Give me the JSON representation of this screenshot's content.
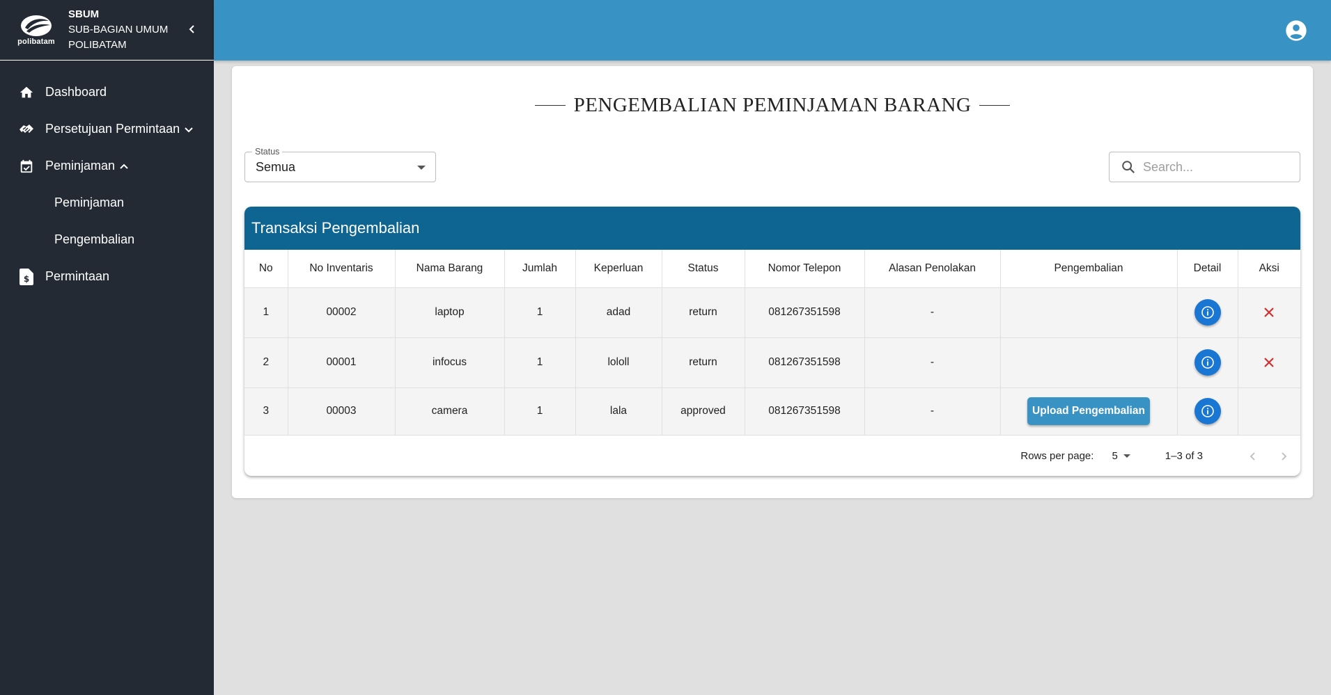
{
  "brand": {
    "logo_text": "polibatam",
    "line1": "SBUM",
    "line2": "SUB-BAGIAN UMUM",
    "line3": "POLIBATAM"
  },
  "sidebar": {
    "items": [
      {
        "label": "Dashboard",
        "icon": "home-icon"
      },
      {
        "label": "Persetujuan Permintaan",
        "icon": "handshake-icon",
        "chevron": "chevron-down-icon"
      },
      {
        "label": "Peminjaman",
        "icon": "calendar-check-icon",
        "chevron": "chevron-up-icon"
      },
      {
        "label": "Permintaan",
        "icon": "request-document-icon"
      }
    ],
    "subitems": [
      {
        "label": "Peminjaman"
      },
      {
        "label": "Pengembalian"
      }
    ]
  },
  "page": {
    "title": "PENGEMBALIAN PEMINJAMAN BARANG"
  },
  "filter": {
    "status_label": "Status",
    "status_value": "Semua"
  },
  "search": {
    "placeholder": "Search..."
  },
  "table": {
    "title": "Transaksi Pengembalian",
    "columns": [
      "No",
      "No Inventaris",
      "Nama Barang",
      "Jumlah",
      "Keperluan",
      "Status",
      "Nomor Telepon",
      "Alasan Penolakan",
      "Pengembalian",
      "Detail",
      "Aksi"
    ],
    "rows": [
      {
        "no": "1",
        "inventaris": "00002",
        "nama": "laptop",
        "jumlah": "1",
        "keperluan": "adad",
        "status": "return",
        "telepon": "081267351598",
        "alasan": "-"
      },
      {
        "no": "2",
        "inventaris": "00001",
        "nama": "infocus",
        "jumlah": "1",
        "keperluan": "lololl",
        "status": "return",
        "telepon": "081267351598",
        "alasan": "-"
      },
      {
        "no": "3",
        "inventaris": "00003",
        "nama": "camera",
        "jumlah": "1",
        "keperluan": "lala",
        "status": "approved",
        "telepon": "081267351598",
        "alasan": "-",
        "upload_label": "Upload Pengembalian"
      }
    ]
  },
  "pagination": {
    "rows_per_page_label": "Rows per page:",
    "rows_per_page": "5",
    "range": "1–3 of 3"
  },
  "colors": {
    "sidebar": "#232a33",
    "topbar": "#3893c4",
    "table_header": "#0e6591",
    "info_button": "#1976d2",
    "delete": "#d32f2f"
  }
}
